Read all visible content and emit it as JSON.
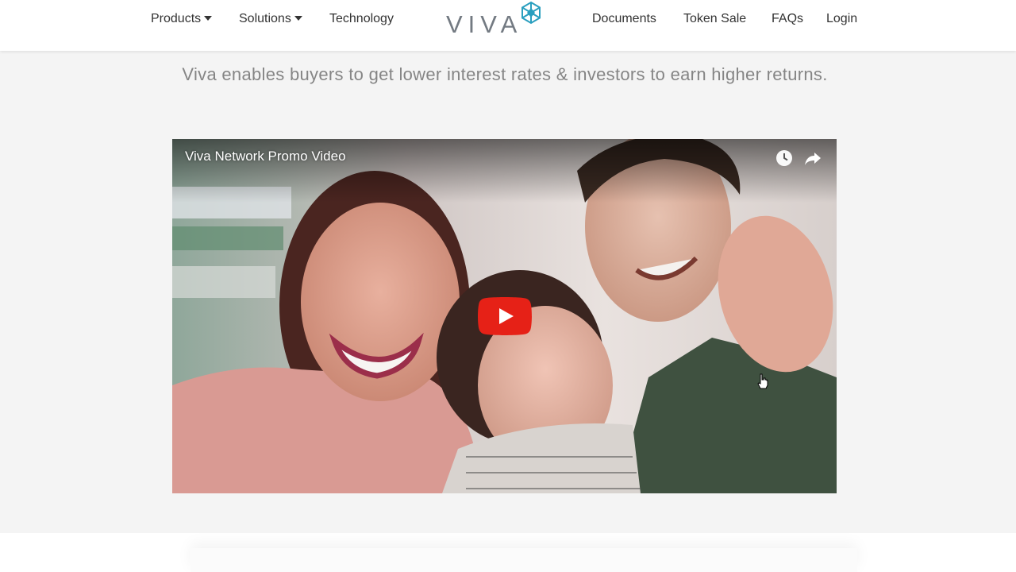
{
  "nav": {
    "left": [
      {
        "label": "Products",
        "dropdown": true
      },
      {
        "label": "Solutions",
        "dropdown": true
      },
      {
        "label": "Technology",
        "dropdown": false
      }
    ],
    "right": [
      {
        "label": "Documents"
      },
      {
        "label": "Token Sale"
      },
      {
        "label": "FAQs"
      },
      {
        "label": "Login"
      }
    ]
  },
  "logo": {
    "text": "VIVA",
    "icon": "snowflake-logo-icon",
    "color_text": "#737a82",
    "color_mark": "#2a9fbf"
  },
  "tagline": "Viva enables buyers to get lower interest rates & investors to earn higher returns.",
  "video": {
    "title": "Viva Network Promo Video",
    "icons": [
      "watch-later-icon",
      "share-icon",
      "youtube-play-icon"
    ],
    "play_color": "#e62117"
  }
}
